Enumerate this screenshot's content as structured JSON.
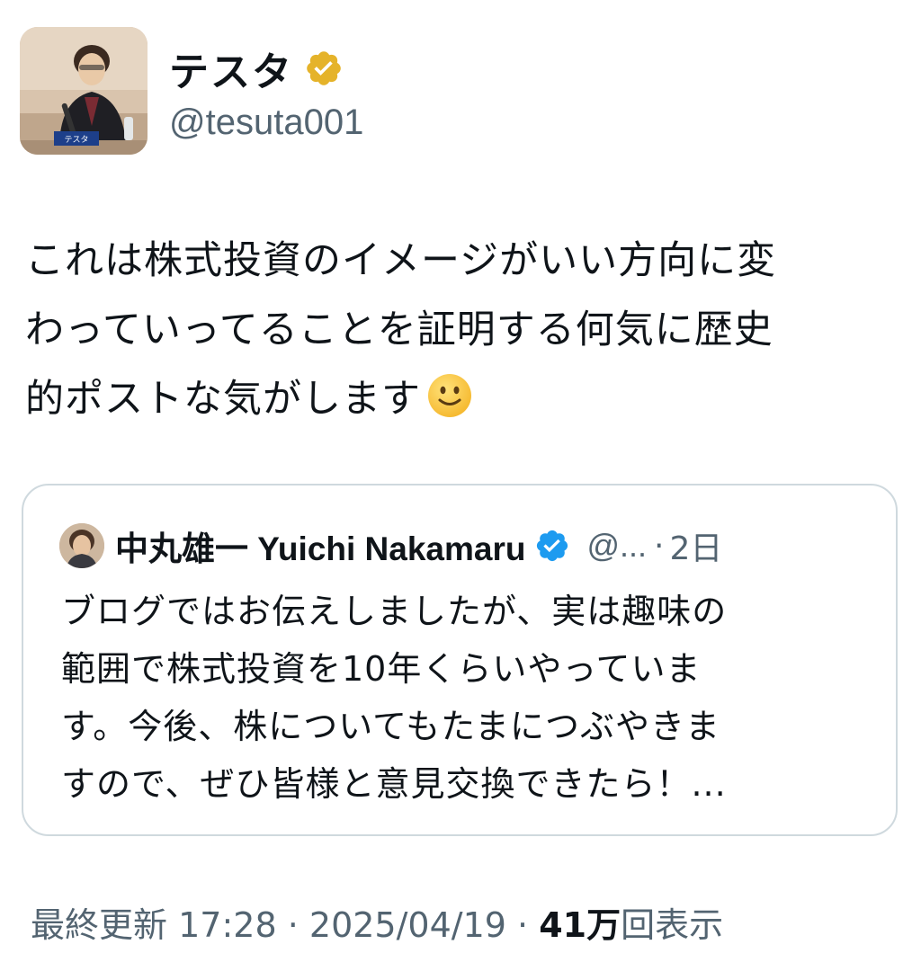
{
  "author": {
    "display_name": "テスタ",
    "handle": "@tesuta001",
    "avatar_caption": "テスタ",
    "verified_badge_icon": "verified-gold-badge-icon"
  },
  "tweet": {
    "lines": [
      "これは株式投資のイメージがいい方向に変",
      "わっていってることを証明する何気に歴史",
      "的ポストな気がします"
    ],
    "emoji_icon": "slightly-smiling-face-icon"
  },
  "quote": {
    "display_name": "中丸雄一 Yuichi Nakamaru",
    "handle": "@...",
    "separator": "·",
    "time": "2日",
    "verified_badge_icon": "verified-blue-badge-icon",
    "lines": [
      "ブログではお伝えしましたが、実は趣味の",
      "範囲で株式投資を10年くらいやっていま",
      "す。今後、株についてもたまにつぶやきま",
      "すので、ぜひ皆様と意見交換できたら！..."
    ]
  },
  "meta": {
    "updated_label": "最終更新",
    "time": "17:28",
    "dot1": "·",
    "date": "2025/04/19",
    "dot2": "·",
    "views_count": "41万",
    "views_label": "回表示"
  },
  "colors": {
    "primary_text": "#0f1419",
    "secondary_text": "#536471",
    "card_border": "#cfd9de",
    "verified_gold": "#e5b32a",
    "verified_blue": "#1d9bf0"
  }
}
